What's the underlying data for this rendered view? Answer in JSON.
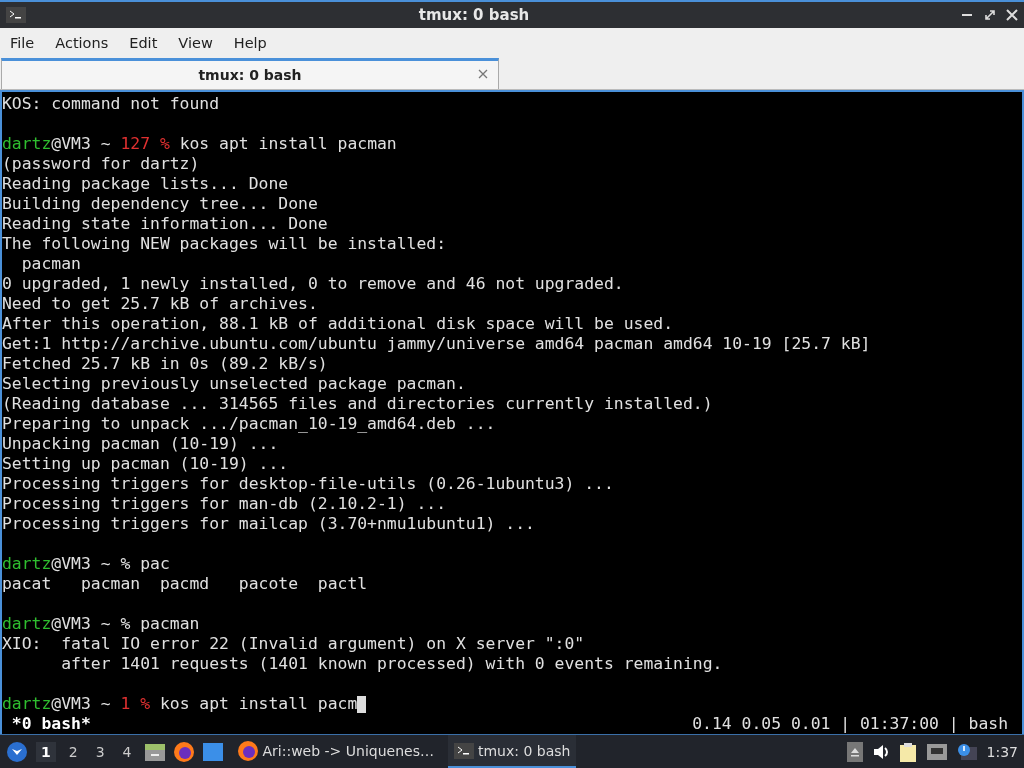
{
  "window": {
    "title": "tmux: 0 bash"
  },
  "menu": [
    "File",
    "Actions",
    "Edit",
    "View",
    "Help"
  ],
  "tabs": [
    {
      "label": "tmux: 0 bash",
      "selected": true
    }
  ],
  "terminal": {
    "lines": [
      {
        "kind": "output",
        "text": "KOS: command not found"
      },
      {
        "kind": "blank"
      },
      {
        "kind": "prompt",
        "user": "dartz",
        "host": "@VM3 ~ ",
        "exit_code": "127 %",
        "command": " kos apt install pacman"
      },
      {
        "kind": "output",
        "text": "(password for dartz)"
      },
      {
        "kind": "output",
        "text": "Reading package lists... Done"
      },
      {
        "kind": "output",
        "text": "Building dependency tree... Done"
      },
      {
        "kind": "output",
        "text": "Reading state information... Done"
      },
      {
        "kind": "output",
        "text": "The following NEW packages will be installed:"
      },
      {
        "kind": "output",
        "text": "  pacman"
      },
      {
        "kind": "output",
        "text": "0 upgraded, 1 newly installed, 0 to remove and 46 not upgraded."
      },
      {
        "kind": "output",
        "text": "Need to get 25.7 kB of archives."
      },
      {
        "kind": "output",
        "text": "After this operation, 88.1 kB of additional disk space will be used."
      },
      {
        "kind": "output",
        "text": "Get:1 http://archive.ubuntu.com/ubuntu jammy/universe amd64 pacman amd64 10-19 [25.7 kB]"
      },
      {
        "kind": "output",
        "text": "Fetched 25.7 kB in 0s (89.2 kB/s)"
      },
      {
        "kind": "output",
        "text": "Selecting previously unselected package pacman."
      },
      {
        "kind": "output",
        "text": "(Reading database ... 314565 files and directories currently installed.)"
      },
      {
        "kind": "output",
        "text": "Preparing to unpack .../pacman_10-19_amd64.deb ..."
      },
      {
        "kind": "output",
        "text": "Unpacking pacman (10-19) ..."
      },
      {
        "kind": "output",
        "text": "Setting up pacman (10-19) ..."
      },
      {
        "kind": "output",
        "text": "Processing triggers for desktop-file-utils (0.26-1ubuntu3) ..."
      },
      {
        "kind": "output",
        "text": "Processing triggers for man-db (2.10.2-1) ..."
      },
      {
        "kind": "output",
        "text": "Processing triggers for mailcap (3.70+nmu1ubuntu1) ..."
      },
      {
        "kind": "blank"
      },
      {
        "kind": "prompt",
        "user": "dartz",
        "host": "@VM3 ~ ",
        "symbol": "%",
        "command": " pac"
      },
      {
        "kind": "output",
        "text": "pacat   pacman  pacmd   pacote  pactl"
      },
      {
        "kind": "blank"
      },
      {
        "kind": "prompt",
        "user": "dartz",
        "host": "@VM3 ~ ",
        "symbol": "%",
        "command": " pacman"
      },
      {
        "kind": "output",
        "text": "XIO:  fatal IO error 22 (Invalid argument) on X server \":0\""
      },
      {
        "kind": "output",
        "text": "      after 1401 requests (1401 known processed) with 0 events remaining."
      },
      {
        "kind": "blank"
      },
      {
        "kind": "prompt",
        "user": "dartz",
        "host": "@VM3 ~ ",
        "exit_code": "1 %",
        "command": " kos apt install pacm",
        "cursor": true
      }
    ],
    "status_bar": {
      "left": " *0 bash*",
      "right": "0.14 0.05 0.01 | 01:37:00 | bash"
    }
  },
  "taskbar": {
    "workspaces": [
      {
        "label": "1",
        "selected": true
      },
      {
        "label": "2",
        "selected": false
      },
      {
        "label": "3",
        "selected": false
      },
      {
        "label": "4",
        "selected": false
      }
    ],
    "tasks": [
      {
        "kind": "browser",
        "label": "Ari::web -> Uniquenes…",
        "selected": false
      },
      {
        "kind": "terminal",
        "label": "tmux: 0 bash",
        "selected": true
      }
    ],
    "clock": "1:37"
  }
}
